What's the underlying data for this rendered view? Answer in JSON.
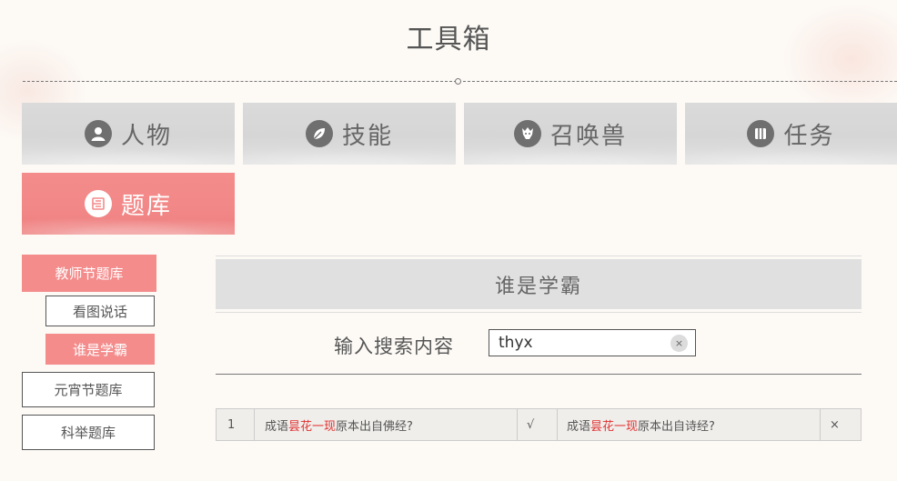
{
  "page": {
    "title": "工具箱"
  },
  "categories": [
    {
      "label": "人物",
      "icon": "person-icon"
    },
    {
      "label": "技能",
      "icon": "leaf-icon"
    },
    {
      "label": "召唤兽",
      "icon": "beast-icon"
    },
    {
      "label": "任务",
      "icon": "book-icon"
    },
    {
      "label": "题库",
      "icon": "question-bank-icon",
      "active": true
    }
  ],
  "sidebar": {
    "items": [
      {
        "label": "教师节题库",
        "active": true,
        "level": 1
      },
      {
        "label": "看图说话",
        "active": false,
        "level": 2
      },
      {
        "label": "谁是学霸",
        "active": true,
        "level": 2
      },
      {
        "label": "元宵节题库",
        "active": false,
        "level": 1
      },
      {
        "label": "科举题库",
        "active": false,
        "level": 1
      }
    ]
  },
  "panel": {
    "title": "谁是学霸",
    "search": {
      "label": "输入搜索内容",
      "value": "thyx",
      "clear_label": "×"
    }
  },
  "results": [
    {
      "index": "1",
      "q1": {
        "prefix": "成语",
        "highlight": "昙花一现",
        "suffix": "原本出自佛经?"
      },
      "q1_mark": "√",
      "q2": {
        "prefix": "成语",
        "highlight": "昙花一现",
        "suffix": "原本出自诗经?"
      },
      "q2_mark": "×"
    }
  ],
  "colors": {
    "accent": "#f48c8c",
    "tile_gray": "#d8d8d8",
    "highlight": "#e03030"
  }
}
